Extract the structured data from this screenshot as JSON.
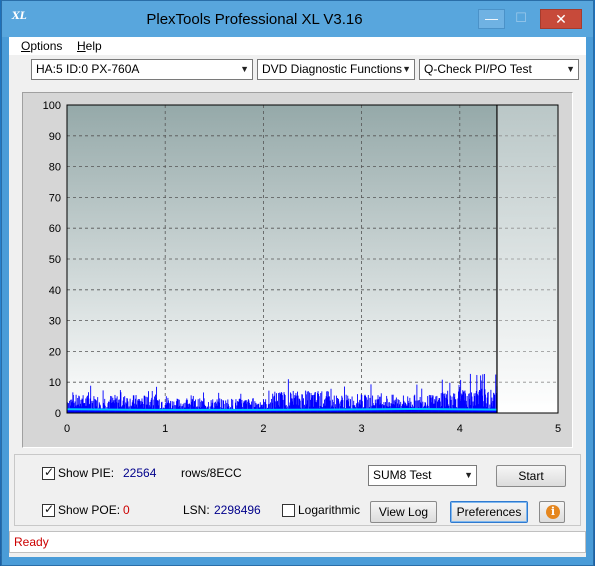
{
  "window": {
    "title": "PlexTools Professional XL V3.16",
    "app_icon_text": "XL",
    "minimize_glyph": "—",
    "maximize_glyph": "☐",
    "close_glyph": "✕"
  },
  "menu": {
    "items": [
      {
        "accel": "O",
        "rest": "ptions"
      },
      {
        "accel": "H",
        "rest": "elp"
      }
    ]
  },
  "toolbar": {
    "drive": "HA:5 ID:0  PX-760A",
    "function": "DVD Diagnostic Functions",
    "test": "Q-Check PI/PO Test"
  },
  "chart_data": {
    "type": "bar",
    "title": "",
    "xlabel": "",
    "ylabel": "",
    "xlim": [
      0,
      5
    ],
    "ylim": [
      0,
      100
    ],
    "x_ticks": [
      "0",
      "1",
      "2",
      "3",
      "4",
      "5"
    ],
    "y_ticks": [
      "0",
      "10",
      "20",
      "30",
      "40",
      "50",
      "60",
      "70",
      "80",
      "90",
      "100"
    ],
    "grid": true,
    "end_marker_x": 4.38,
    "series": [
      {
        "name": "PIE",
        "color": "#0000ff",
        "x_end": 4.38,
        "typical_range": [
          1,
          6
        ],
        "peaks_near_end": [
          12,
          13
        ]
      },
      {
        "name": "average",
        "color": "#00c8ff",
        "x_end": 4.38,
        "values": [
          1.2,
          1.0,
          1.0,
          1.1,
          1.3,
          1.1
        ]
      }
    ]
  },
  "controls": {
    "show_pie_label": "Show PIE:",
    "show_pie_checked": true,
    "pie_value": "22564",
    "pie_unit": "rows/8ECC",
    "show_poe_label": "Show POE:",
    "show_poe_checked": true,
    "poe_value": "0",
    "lsn_label": "LSN:",
    "lsn_value": "2298496",
    "logarithmic_label": "Logarithmic",
    "logarithmic_checked": false,
    "test_mode": "SUM8 Test",
    "start_button": "Start",
    "view_log_button": "View Log",
    "preferences_button": "Preferences",
    "info_glyph": "i"
  },
  "status": {
    "text": "Ready"
  },
  "colors": {
    "chart_bg_top": "#95a9a9",
    "chart_bg_bottom": "#ffffff",
    "bar_color": "#0000ff",
    "avg_color": "#00c8ff",
    "status_color": "#cc0000"
  }
}
